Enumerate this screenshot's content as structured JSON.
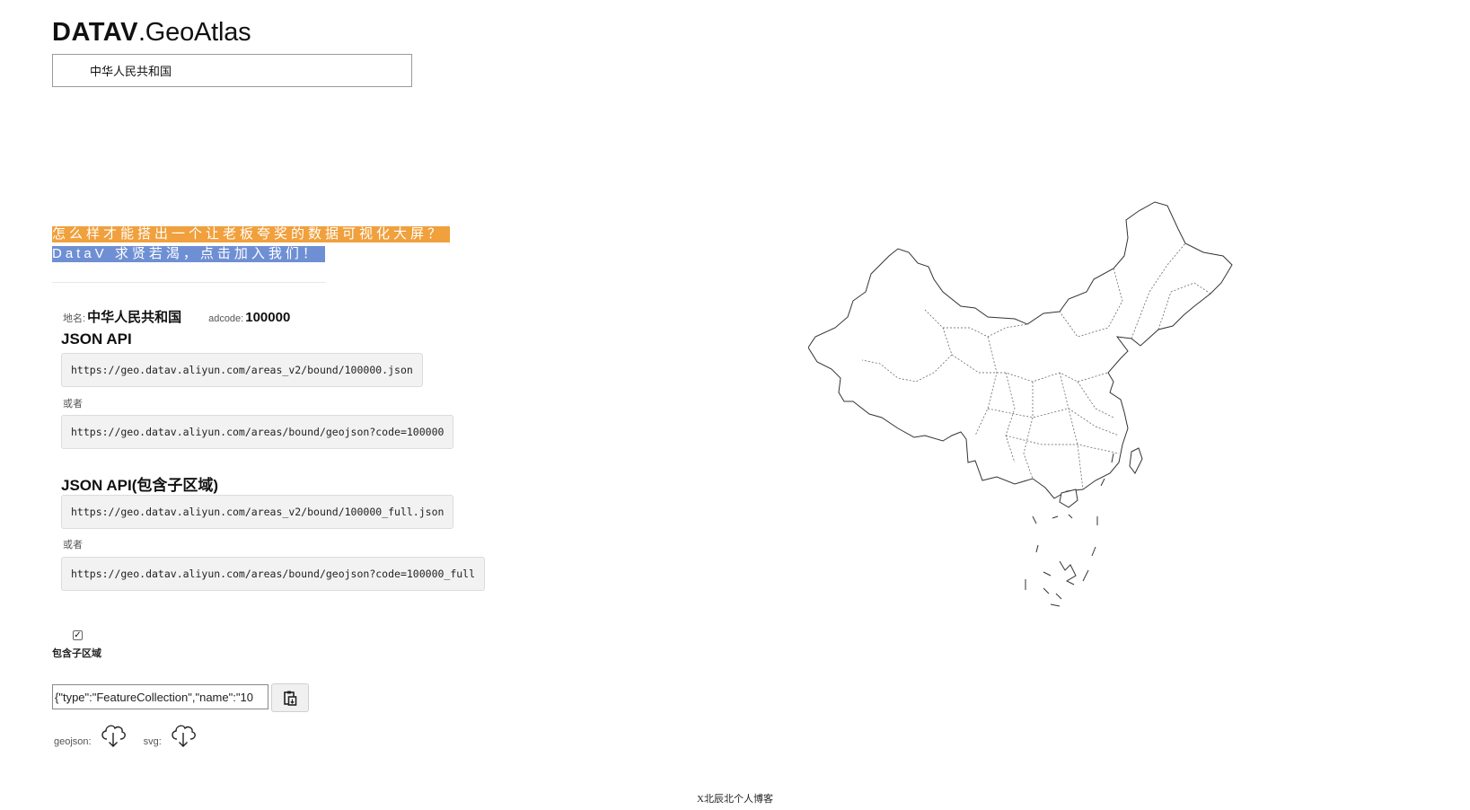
{
  "logo": {
    "bold": "DATAV",
    "light": ".GeoAtlas"
  },
  "region_selector": {
    "value": "中华人民共和国"
  },
  "promo": {
    "line1": "怎么样才能搭出一个让老板夸奖的数据可视化大屏？",
    "line2": "DataV 求贤若渴，点击加入我们！",
    "line1_color": "#f0a03d",
    "line2_color": "#6f8fd4"
  },
  "info": {
    "name_label": "地名:",
    "name_value": "中华人民共和国",
    "adcode_label": "adcode:",
    "adcode_value": "100000"
  },
  "json_api": {
    "title": "JSON API",
    "url_v2": "https://geo.datav.aliyun.com/areas_v2/bound/100000.json",
    "or_label": "或者",
    "url_geojson": "https://geo.datav.aliyun.com/areas/bound/geojson?code=100000"
  },
  "json_api_full": {
    "title": "JSON API(包含子区域)",
    "url_v2": "https://geo.datav.aliyun.com/areas_v2/bound/100000_full.json",
    "or_label": "或者",
    "url_geojson": "https://geo.datav.aliyun.com/areas/bound/geojson?code=100000_full"
  },
  "include_subregions": {
    "checked": true,
    "label": "包含子区域"
  },
  "json_output": {
    "value": "{\"type\":\"FeatureCollection\",\"name\":\"10"
  },
  "copy_button": {
    "icon": "clipboard-icon"
  },
  "downloads": [
    {
      "label": "geojson:",
      "icon": "cloud-download-icon"
    },
    {
      "label": "svg:",
      "icon": "cloud-download-icon"
    }
  ],
  "footer": {
    "text": "X北辰北个人博客"
  },
  "map": {
    "region": "中华人民共和国",
    "style": "outline"
  }
}
